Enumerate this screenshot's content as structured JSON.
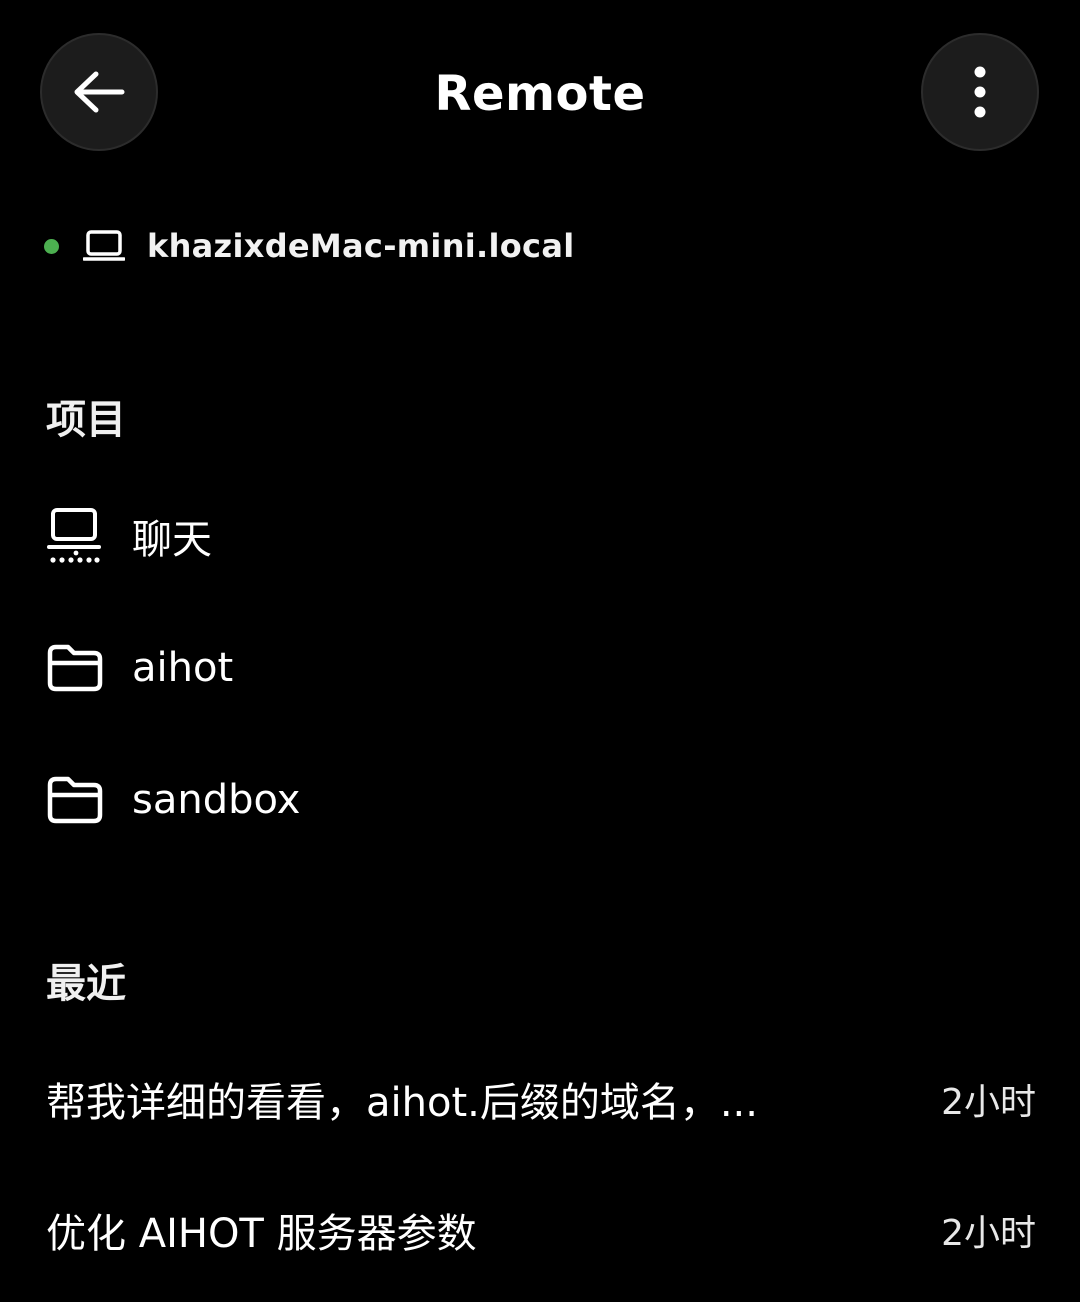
{
  "header": {
    "title": "Remote",
    "back_icon": "arrow-left-icon",
    "more_icon": "more-vertical-icon"
  },
  "host": {
    "name": "khazixdeMac-mini.local",
    "status": "online",
    "status_color": "#4caf50",
    "icon": "laptop-icon"
  },
  "projects": {
    "heading": "项目",
    "items": [
      {
        "label": "聊天",
        "icon": "chat-laptop-icon"
      },
      {
        "label": "aihot",
        "icon": "folder-icon"
      },
      {
        "label": "sandbox",
        "icon": "folder-icon"
      }
    ]
  },
  "recent": {
    "heading": "最近",
    "items": [
      {
        "title": "帮我详细的看看，aihot.后缀的域名，...",
        "time": "2小时"
      },
      {
        "title": "优化 AIHOT 服务器参数",
        "time": "2小时"
      }
    ]
  }
}
